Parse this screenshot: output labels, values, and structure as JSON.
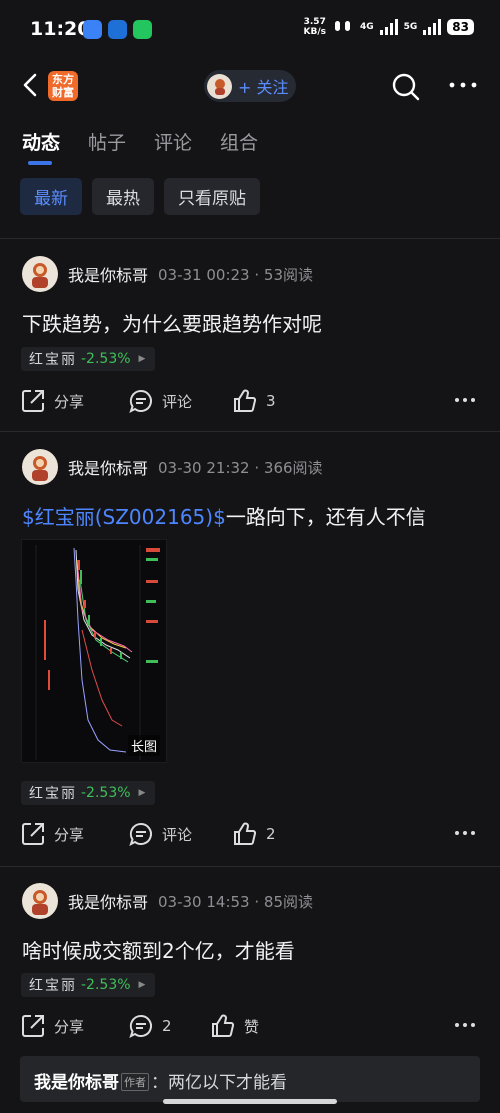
{
  "status_bar": {
    "time": "11:20",
    "net_speed_value": "3.57",
    "net_speed_unit": "KB/s",
    "sig1": "4G",
    "sig2": "5G",
    "battery": "83"
  },
  "header": {
    "logo_line1": "东方",
    "logo_line2": "财富",
    "follow_label": "+ 关注"
  },
  "tabs": [
    "动态",
    "帖子",
    "评论",
    "组合"
  ],
  "filters": [
    "最新",
    "最热",
    "只看原贴"
  ],
  "colors": {
    "accent": "#5b8dff",
    "down": "#3fbf58",
    "background": "#141416"
  },
  "posts": [
    {
      "author": "我是你标哥",
      "meta": "03-31 00:23 · 53阅读",
      "text": "下跌趋势，为什么要跟趋势作对呢",
      "stock_name": "红宝丽",
      "stock_change": "-2.53%",
      "share": "分享",
      "comment": "评论",
      "likes": "3"
    },
    {
      "author": "我是你标哥",
      "meta": "03-30 21:32 · 366阅读",
      "text_tag": "$红宝丽(SZ002165)$",
      "text": "一路向下，还有人不信",
      "image_badge": "长图",
      "stock_name": "红宝丽",
      "stock_change": "-2.53%",
      "share": "分享",
      "comment": "评论",
      "likes": "2"
    },
    {
      "author": "我是你标哥",
      "meta": "03-30 14:53 · 85阅读",
      "text": "啥时候成交额到2个亿，才能看",
      "stock_name": "红宝丽",
      "stock_change": "-2.53%",
      "share": "分享",
      "comment": "2",
      "likes": "赞"
    }
  ],
  "reply": {
    "user": "我是你标哥",
    "tag": "作者",
    "text": "：两亿以下才能看"
  }
}
